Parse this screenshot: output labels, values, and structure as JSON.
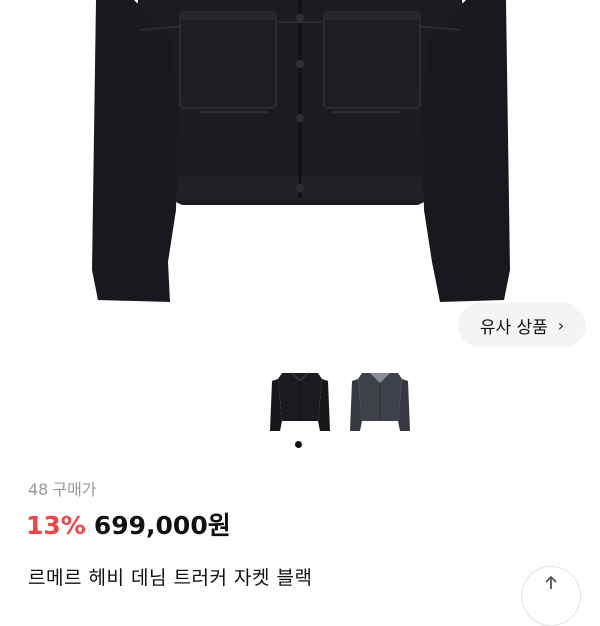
{
  "similar_products": {
    "label": "유사 상품",
    "chevron": "›",
    "icon": "chevron-right-icon"
  },
  "thumbnails": [
    {
      "name": "black-jacket",
      "color": "#1a1b20"
    },
    {
      "name": "gray-denim-jacket",
      "color": "#3e4148"
    }
  ],
  "carousel": {
    "active_index": 0
  },
  "product": {
    "buyer_count": "48",
    "buyer_label": "구매가",
    "discount": "13%",
    "price": "699,000원",
    "title": "르메르 헤비 데님 트러커 자켓 블랙"
  },
  "colors": {
    "discount": "#ee4545",
    "jacket": "#1b1c21"
  }
}
